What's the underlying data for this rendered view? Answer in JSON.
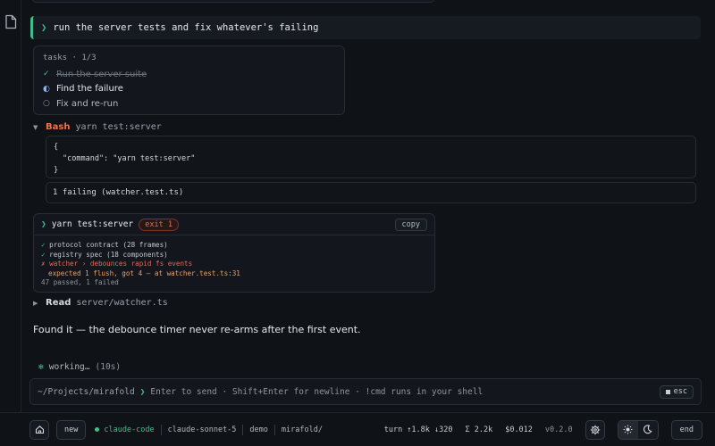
{
  "prompt": {
    "text": "run the server tests and fix whatever's failing"
  },
  "tasks": {
    "header": "tasks · 1/3",
    "items": [
      {
        "label": "Run the server suite",
        "status": "done",
        "mark": "✓"
      },
      {
        "label": "Find the failure",
        "status": "active",
        "mark": "◐"
      },
      {
        "label": "Fix and re-run",
        "status": "pending",
        "mark": "○"
      }
    ]
  },
  "bash_tool": {
    "name": "Bash",
    "arg": "yarn test:server",
    "json_open": "{",
    "json_line": "\"command\": \"yarn test:server\"",
    "json_close": "}",
    "result": "1 failing (watcher.test.ts)"
  },
  "terminal": {
    "command": "yarn test:server",
    "exit_badge": "exit 1",
    "copy_label": "copy",
    "lines": {
      "pass1": "protocol contract (28 frames)",
      "pass2": "registry spec (18 components)",
      "fail": "watcher › debounces rapid fs events",
      "fail_detail": "expected 1 flush, got 4 — at watcher.test.ts:31",
      "summary": "47 passed, 1 failed"
    }
  },
  "read_tool": {
    "name": "Read",
    "arg": "server/watcher.ts"
  },
  "message": "Found it — the debounce timer never re-arms after the first event.",
  "working": {
    "label": "working…",
    "elapsed": "(10s)"
  },
  "input": {
    "cwd": "~/Projects/mirafold",
    "placeholder": "Enter to send · Shift+Enter for newline · !cmd runs in your shell",
    "esc_label": "esc"
  },
  "statusbar": {
    "new_label": "new",
    "agent": "claude-code",
    "model": "claude-sonnet-5",
    "mode": "demo",
    "project": "mirafold/",
    "turn": "turn ↑1.8k ↓320",
    "total": "Σ 2.2k",
    "cost": "$0.012",
    "version": "v0.2.0",
    "end_label": "end"
  },
  "colors": {
    "accent": "#3fbf8a",
    "bash": "#e8774a",
    "error": "#e8665a",
    "background": "#0f1217"
  },
  "icons": [
    "document-icon",
    "home-icon",
    "gear-icon",
    "sun-icon",
    "moon-icon",
    "stop-icon"
  ]
}
